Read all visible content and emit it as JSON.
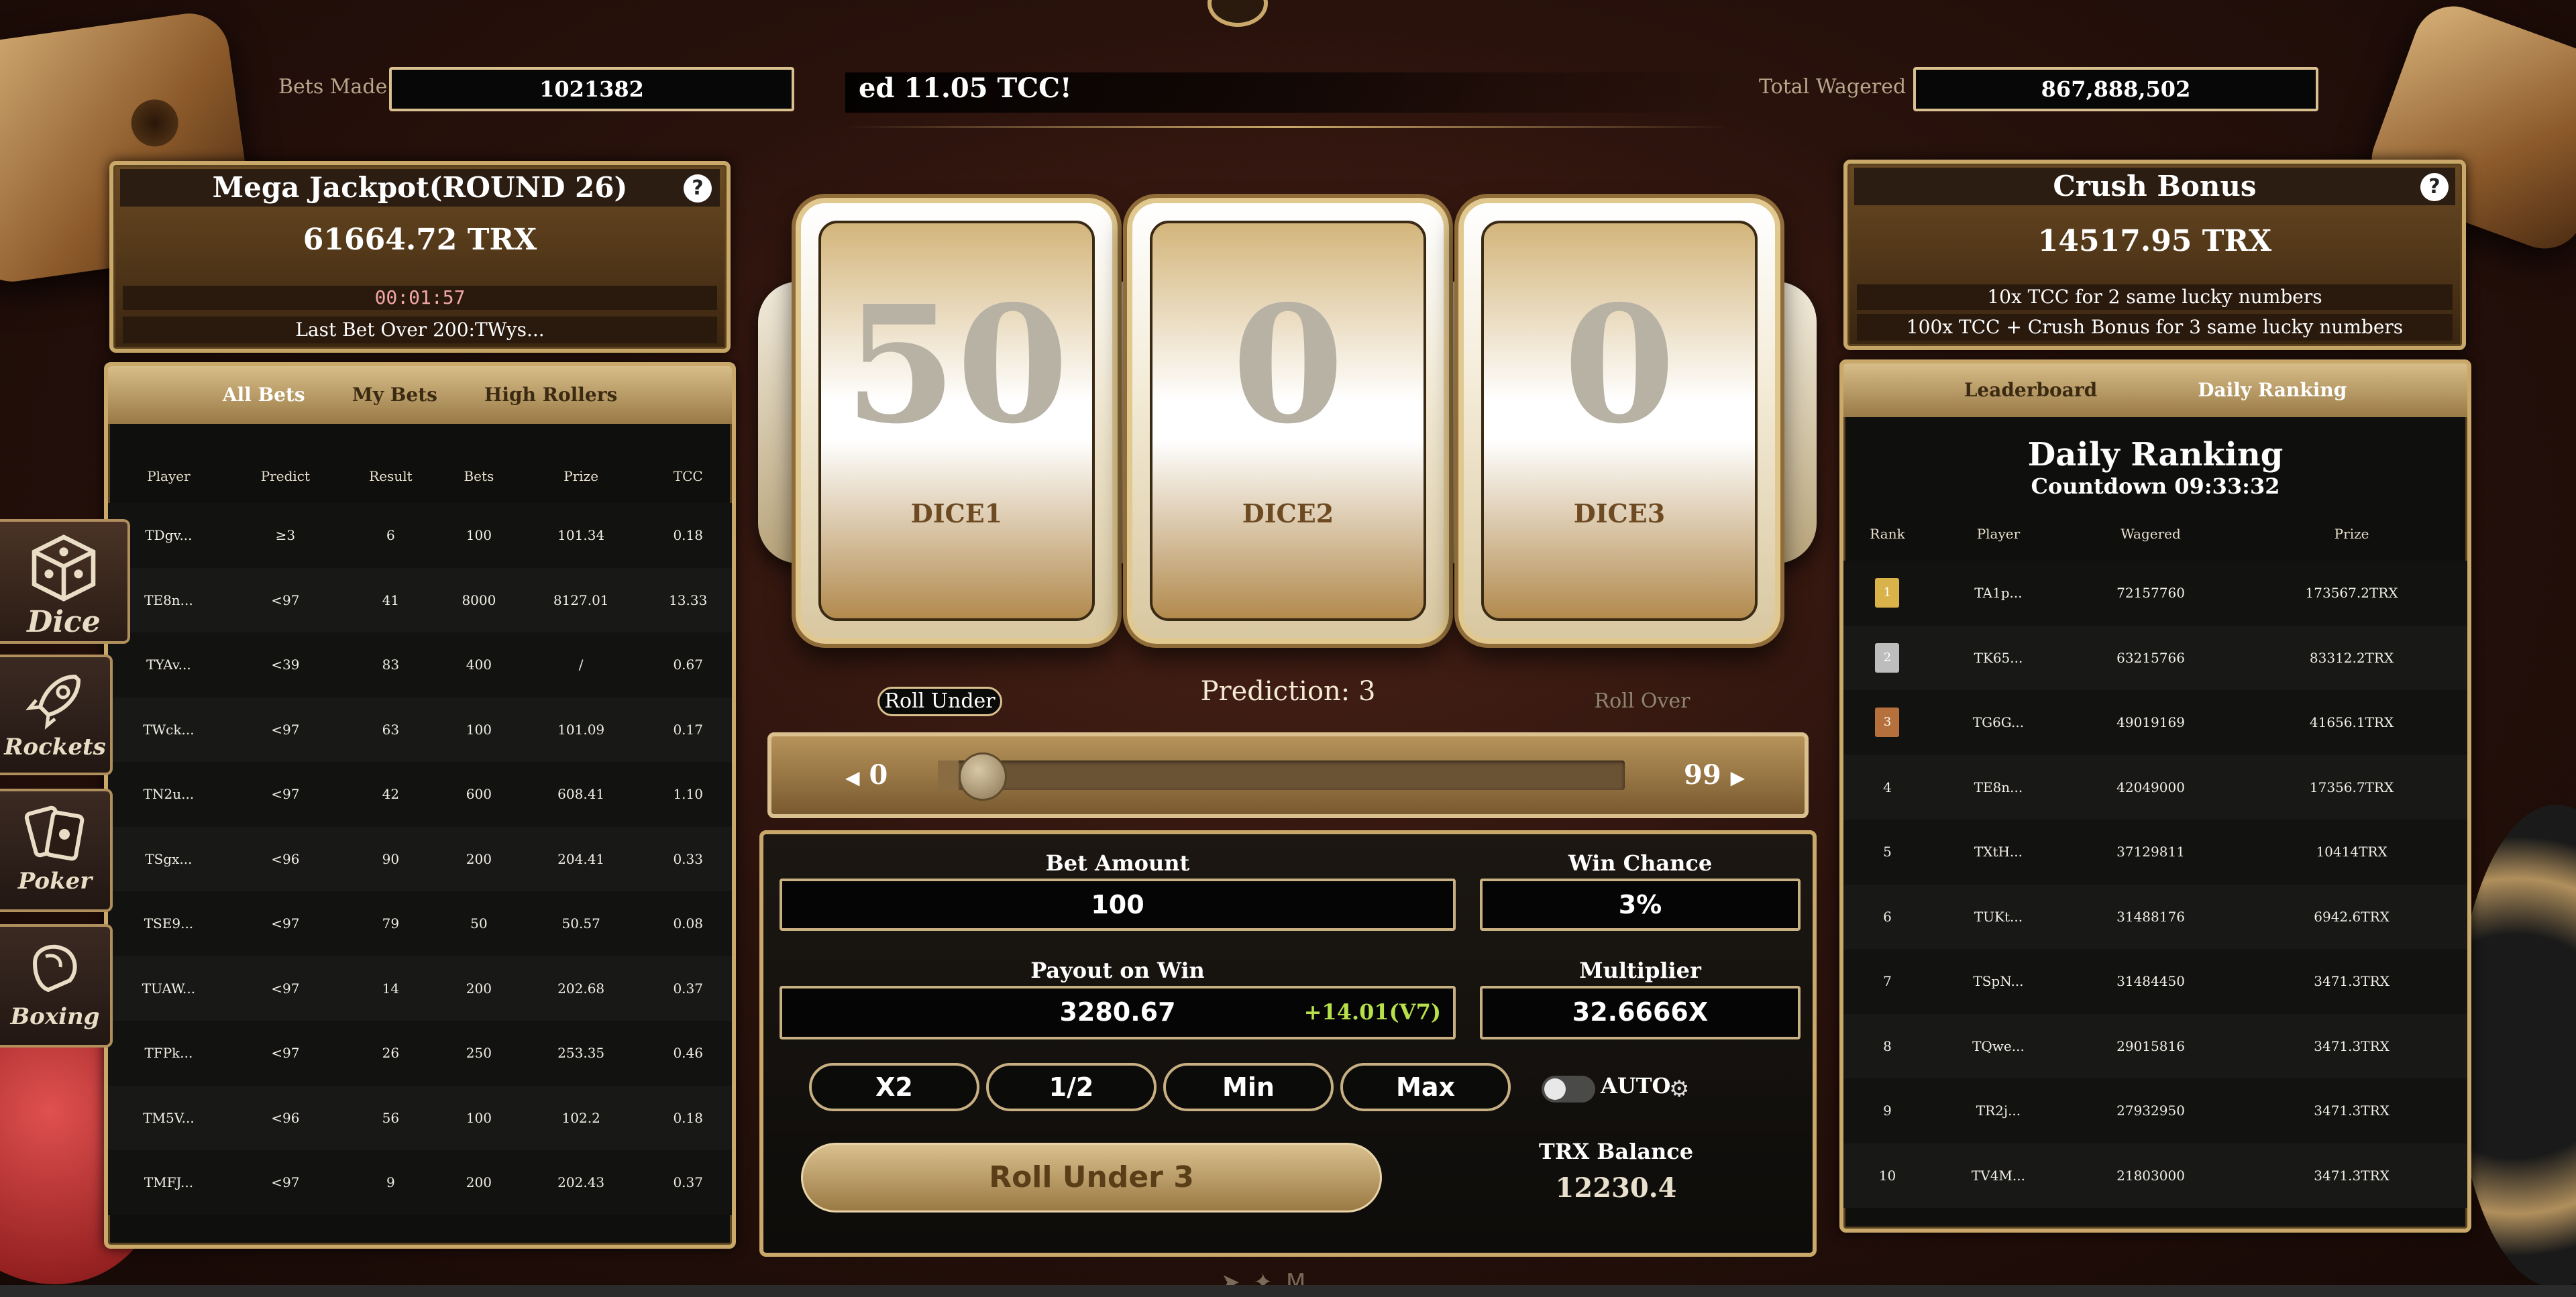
{
  "stats": {
    "bets_made_label": "Bets Made",
    "bets_made_value": "1021382",
    "ticker_text": "ed 11.05 TCC!",
    "total_wagered_label": "Total Wagered",
    "total_wagered_value": "867,888,502"
  },
  "jackpot": {
    "title": "Mega Jackpot(ROUND 26)",
    "amount": "61664.72 TRX",
    "timer": "00:01:57",
    "last_bet": "Last Bet Over 200:TWys..."
  },
  "crush": {
    "title": "Crush Bonus",
    "amount": "14517.95 TRX",
    "line1": "10x TCC for 2 same lucky numbers",
    "line2": "100x TCC + Crush Bonus for 3 same lucky numbers"
  },
  "help_symbol": "?",
  "bets_table": {
    "tabs": [
      "All Bets",
      "My Bets",
      "High Rollers"
    ],
    "columns": [
      "Player",
      "Predict",
      "Result",
      "Bets",
      "Prize",
      "TCC"
    ],
    "rows": [
      [
        "TDgv...",
        "≥3",
        "6",
        "100",
        "101.34",
        "0.18"
      ],
      [
        "TE8n...",
        "<97",
        "41",
        "8000",
        "8127.01",
        "13.33"
      ],
      [
        "TYAv...",
        "<39",
        "83",
        "400",
        "/",
        "0.67"
      ],
      [
        "TWck...",
        "<97",
        "63",
        "100",
        "101.09",
        "0.17"
      ],
      [
        "TN2u...",
        "<97",
        "42",
        "600",
        "608.41",
        "1.10"
      ],
      [
        "TSgx...",
        "<96",
        "90",
        "200",
        "204.41",
        "0.33"
      ],
      [
        "TSE9...",
        "<97",
        "79",
        "50",
        "50.57",
        "0.08"
      ],
      [
        "TUAW...",
        "<97",
        "14",
        "200",
        "202.68",
        "0.37"
      ],
      [
        "TFPk...",
        "<97",
        "26",
        "250",
        "253.35",
        "0.46"
      ],
      [
        "TM5V...",
        "<96",
        "56",
        "100",
        "102.2",
        "0.18"
      ],
      [
        "TMFJ...",
        "<97",
        "9",
        "200",
        "202.43",
        "0.37"
      ]
    ]
  },
  "nav": {
    "items": [
      {
        "label": "Dice",
        "icon": "dice-icon"
      },
      {
        "label": "Rockets",
        "icon": "rocket-icon"
      },
      {
        "label": "Poker",
        "icon": "cards-icon"
      },
      {
        "label": "Boxing",
        "icon": "boxing-glove-icon"
      }
    ]
  },
  "dice": {
    "values": [
      "50",
      "0",
      "0"
    ],
    "labels": [
      "DICE1",
      "DICE2",
      "DICE3"
    ]
  },
  "prediction": {
    "roll_under_label": "Roll Under",
    "roll_over_label": "Roll Over",
    "text": "Prediction: 3",
    "min_label": "0",
    "max_label": "99",
    "value": 3
  },
  "bet": {
    "bet_amount_label": "Bet Amount",
    "bet_amount_value": "100",
    "win_chance_label": "Win Chance",
    "win_chance_value": "3%",
    "payout_label": "Payout on Win",
    "payout_value": "3280.67",
    "payout_bonus": "+14.01(V7)",
    "multiplier_label": "Multiplier",
    "multiplier_value": "32.6666X",
    "buttons": [
      "X2",
      "1/2",
      "Min",
      "Max"
    ],
    "auto_label": "AUTO",
    "auto_on": false,
    "roll_button": "Roll Under 3",
    "balance_label": "TRX Balance",
    "balance_value": "12230.4"
  },
  "ranking": {
    "tabs": [
      "Leaderboard",
      "Daily Ranking"
    ],
    "active_tab": "Daily Ranking",
    "title": "Daily Ranking",
    "countdown": "Countdown 09:33:32",
    "columns": [
      "Rank",
      "Player",
      "Wagered",
      "Prize"
    ],
    "rows": [
      [
        "1",
        "TA1p...",
        "72157760",
        "173567.2TRX"
      ],
      [
        "2",
        "TK65...",
        "63215766",
        "83312.2TRX"
      ],
      [
        "3",
        "TG6G...",
        "49019169",
        "41656.1TRX"
      ],
      [
        "4",
        "TE8n...",
        "42049000",
        "17356.7TRX"
      ],
      [
        "5",
        "TXtH...",
        "37129811",
        "10414TRX"
      ],
      [
        "6",
        "TUKt...",
        "31488176",
        "6942.6TRX"
      ],
      [
        "7",
        "TSpN...",
        "31484450",
        "3471.3TRX"
      ],
      [
        "8",
        "TQwe...",
        "29015816",
        "3471.3TRX"
      ],
      [
        "9",
        "TR2j...",
        "27932950",
        "3471.3TRX"
      ],
      [
        "10",
        "TV4M...",
        "21803000",
        "3471.3TRX"
      ]
    ],
    "medal_colors": [
      "#d9b24a",
      "#bdbdbd",
      "#b5703c"
    ]
  },
  "colors": {
    "gold": "#c9a869",
    "accent_green": "#b8e04a",
    "timer_pink": "#f2a6a6"
  }
}
